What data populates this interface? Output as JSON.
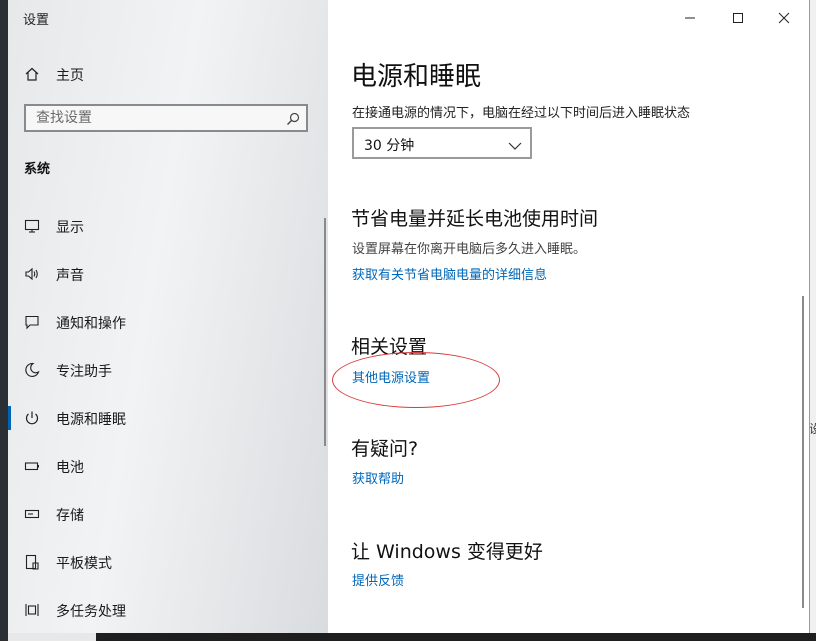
{
  "window": {
    "title": "设置"
  },
  "sidebar": {
    "home_label": "主页",
    "search_placeholder": "查找设置",
    "section_label": "系统",
    "items": [
      {
        "label": "显示",
        "icon": "monitor-icon"
      },
      {
        "label": "声音",
        "icon": "speaker-icon"
      },
      {
        "label": "通知和操作",
        "icon": "notification-icon"
      },
      {
        "label": "专注助手",
        "icon": "moon-icon"
      },
      {
        "label": "电源和睡眠",
        "icon": "power-icon",
        "active": true
      },
      {
        "label": "电池",
        "icon": "battery-icon"
      },
      {
        "label": "存储",
        "icon": "storage-icon"
      },
      {
        "label": "平板模式",
        "icon": "tablet-icon"
      },
      {
        "label": "多任务处理",
        "icon": "multitask-icon"
      }
    ]
  },
  "main": {
    "title": "电源和睡眠",
    "sleep_description": "在接通电源的情况下，电脑在经过以下时间后进入睡眠状态",
    "sleep_value": "30 分钟",
    "save_section": {
      "title": "节省电量并延长电池使用时间",
      "description": "设置屏幕在你离开电脑后多久进入睡眠。",
      "link": "获取有关节省电脑电量的详细信息"
    },
    "related_section": {
      "title": "相关设置",
      "link": "其他电源设置"
    },
    "question_section": {
      "title": "有疑问?",
      "link": "获取帮助"
    },
    "feedback_section": {
      "title": "让 Windows 变得更好",
      "link": "提供反馈"
    }
  },
  "background": {
    "right_fragment": "设"
  },
  "colors": {
    "accent": "#0063b1",
    "link": "#0067b8",
    "annotation": "#d93a3a"
  }
}
